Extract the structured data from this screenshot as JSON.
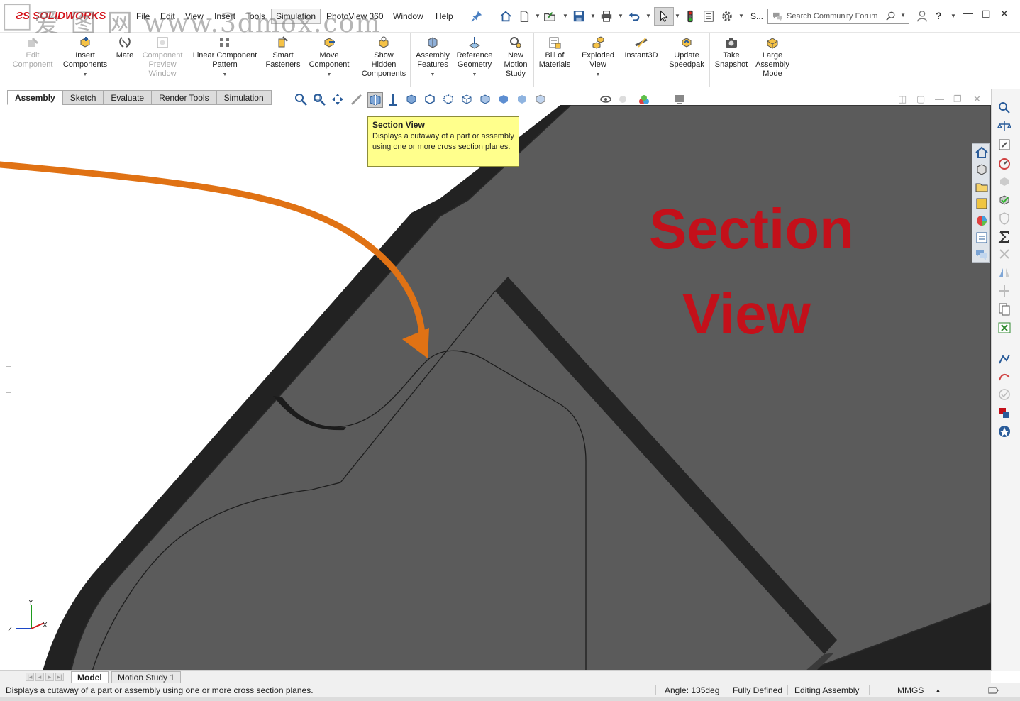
{
  "app": {
    "brand": "SOLIDWORKS",
    "watermark": "爱 图 网 www.3dmox.com"
  },
  "menu": [
    "File",
    "Edit",
    "View",
    "Insert",
    "Tools",
    "Simulation",
    "PhotoView 360",
    "Window",
    "Help"
  ],
  "menu_active": "Simulation",
  "titlebar": {
    "truncated_label": "S...",
    "search_placeholder": "Search Community Forum",
    "help": "?"
  },
  "ribbon": [
    {
      "label": "Edit\nComponent",
      "icon": "edit-component-icon",
      "disabled": true
    },
    {
      "label": "Insert\nComponents",
      "icon": "insert-components-icon",
      "dropdown": true
    },
    {
      "label": "Mate",
      "icon": "mate-icon"
    },
    {
      "label": "Component\nPreview\nWindow",
      "icon": "component-preview-icon",
      "disabled": true
    },
    {
      "label": "Linear Component\nPattern",
      "icon": "linear-pattern-icon",
      "dropdown": true
    },
    {
      "label": "Smart\nFasteners",
      "icon": "smart-fasteners-icon"
    },
    {
      "label": "Move\nComponent",
      "icon": "move-component-icon",
      "dropdown": true
    },
    {
      "label": "Show\nHidden\nComponents",
      "icon": "show-hidden-icon"
    },
    {
      "label": "Assembly\nFeatures",
      "icon": "assembly-features-icon",
      "dropdown": true
    },
    {
      "label": "Reference\nGeometry",
      "icon": "reference-geometry-icon",
      "dropdown": true
    },
    {
      "label": "New\nMotion\nStudy",
      "icon": "motion-study-icon"
    },
    {
      "label": "Bill of\nMaterials",
      "icon": "bom-icon"
    },
    {
      "label": "Exploded\nView",
      "icon": "exploded-view-icon",
      "dropdown": true
    },
    {
      "label": "Instant3D",
      "icon": "instant3d-icon"
    },
    {
      "label": "Update\nSpeedpak",
      "icon": "speedpak-icon"
    },
    {
      "label": "Take\nSnapshot",
      "icon": "snapshot-icon"
    },
    {
      "label": "Large\nAssembly\nMode",
      "icon": "large-assembly-icon"
    }
  ],
  "command_tabs": [
    "Assembly",
    "Sketch",
    "Evaluate",
    "Render Tools",
    "Simulation"
  ],
  "active_command_tab": "Assembly",
  "tooltip": {
    "title": "Section View",
    "body": "Displays a cutaway of a part or assembly using one or more cross section planes."
  },
  "annotation": {
    "line1": "Section",
    "line2": "View",
    "color": "#c4101a",
    "arrow_color": "#e07214"
  },
  "triad": {
    "x": "X",
    "y": "Y",
    "z": "Z"
  },
  "bottom_tabs": [
    "Model",
    "Motion Study 1"
  ],
  "active_bottom_tab": "Model",
  "status": {
    "message": "Displays a cutaway of a part or assembly using one or more cross section planes.",
    "angle": "Angle: 135deg",
    "state": "Fully Defined",
    "mode": "Editing Assembly",
    "units": "MMGS"
  },
  "colors": {
    "part_fill": "#5b5b5b",
    "part_edge": "#262626",
    "tooltip_bg": "#ffff8c"
  }
}
